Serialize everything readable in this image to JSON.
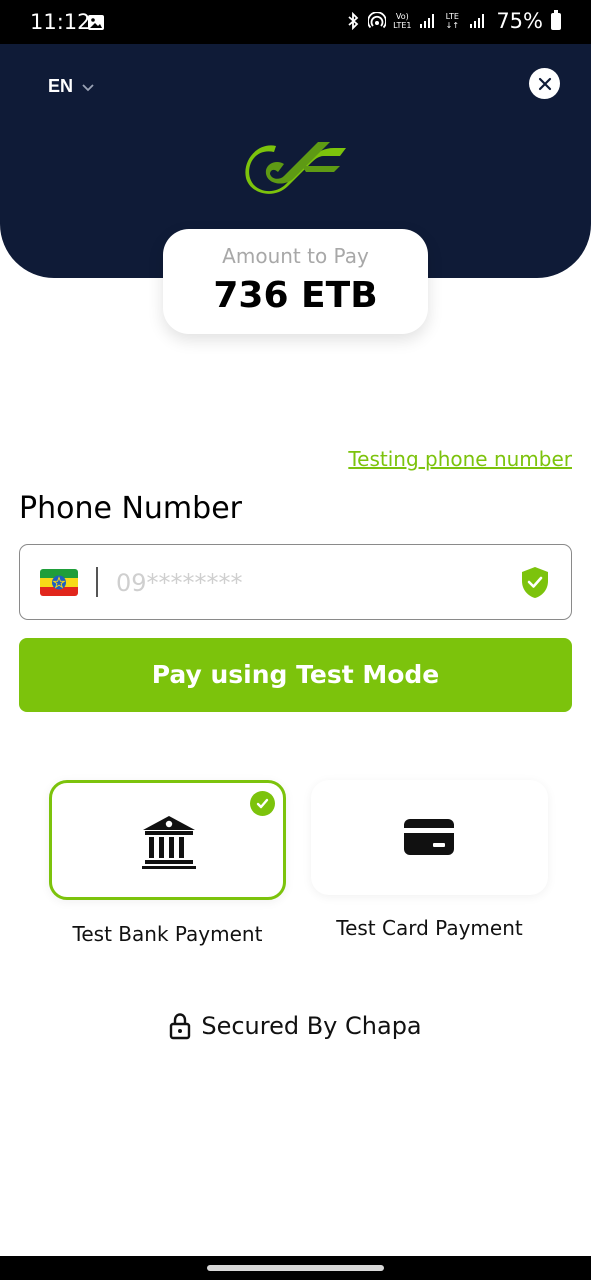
{
  "status_bar": {
    "time": "11:12",
    "network_label_top": "Vo)",
    "network_label_bottom": "LTE1",
    "lte_label": "LTE",
    "battery": "75%",
    "icons": [
      "gallery-icon",
      "bluetooth-icon",
      "hotspot-icon",
      "signal-icon",
      "battery-icon"
    ]
  },
  "header": {
    "language": "EN",
    "background_color": "#0f1b37",
    "icons": [
      "chevron-down-icon",
      "close-icon",
      "chapa-logo"
    ]
  },
  "amount": {
    "label": "Amount to Pay",
    "value": "736 ETB"
  },
  "testing_link": "Testing phone number",
  "phone": {
    "label": "Phone Number",
    "placeholder": "09********",
    "value": "",
    "icons": [
      "ethiopia-flag-icon",
      "shield-check-icon"
    ]
  },
  "pay_button": "Pay using Test Mode",
  "payment_methods": [
    {
      "label": "Test Bank Payment",
      "icon": "bank-icon",
      "selected": true
    },
    {
      "label": "Test Card Payment",
      "icon": "credit-card-icon",
      "selected": false
    }
  ],
  "footer": {
    "secured_text": "Secured By Chapa",
    "icon": "lock-icon"
  },
  "colors": {
    "accent": "#7cc30c",
    "header_bg": "#0f1b37",
    "text": "#111111",
    "muted": "#a8a8a8"
  }
}
